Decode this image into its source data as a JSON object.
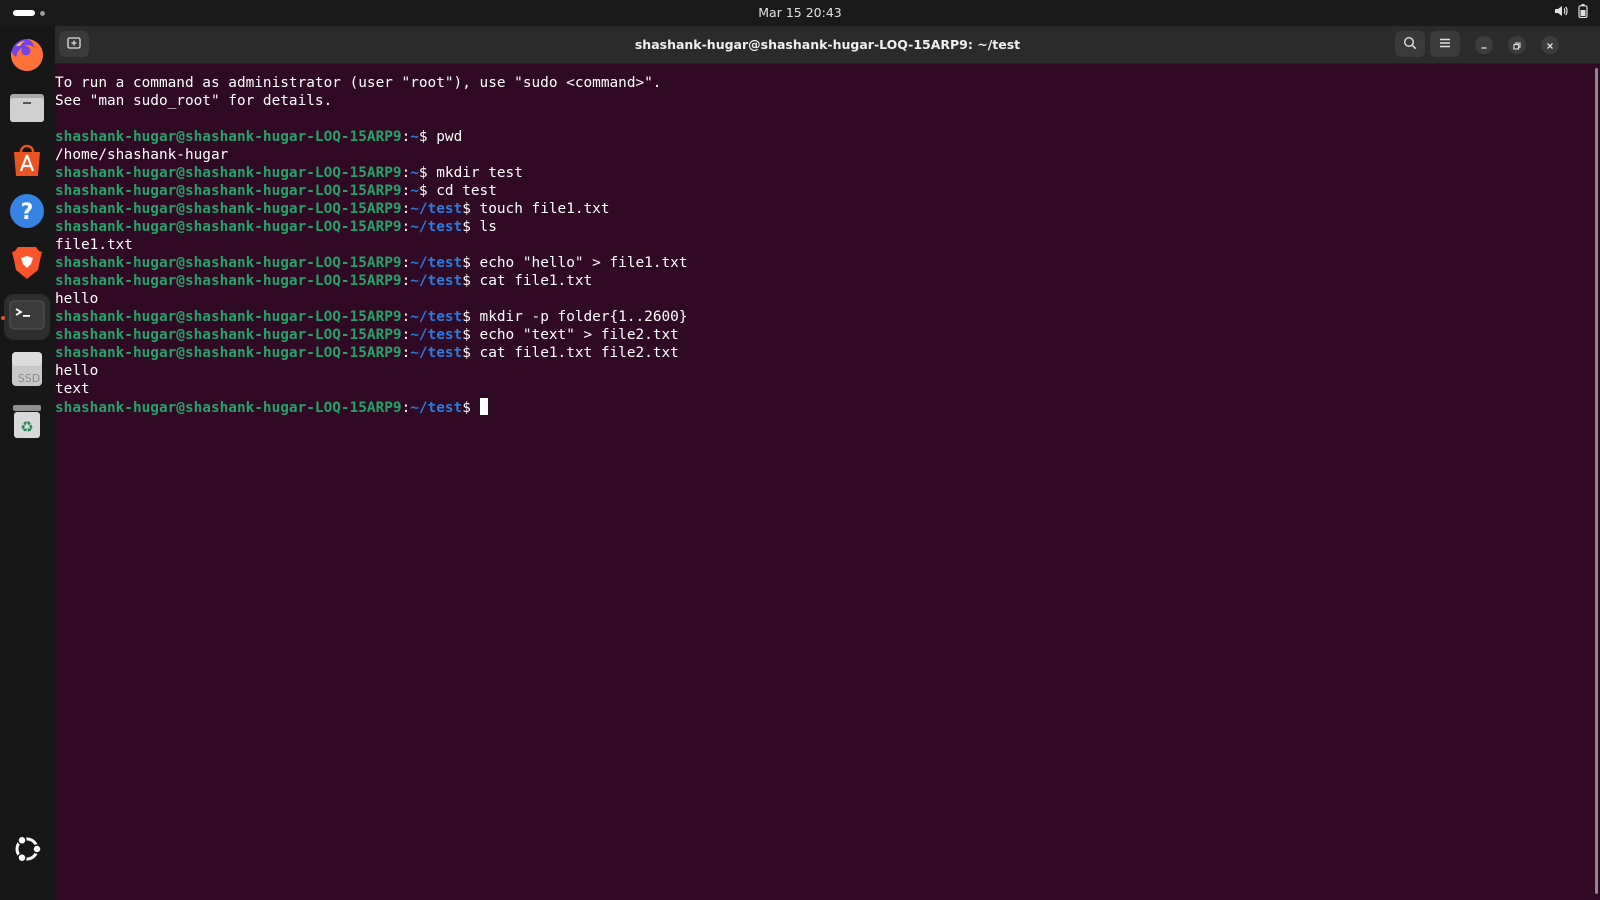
{
  "topbar": {
    "clock": "Mar 15  20:43",
    "icons": [
      "activities-indicator",
      "volume-icon",
      "battery-icon"
    ]
  },
  "dock": {
    "items": [
      {
        "name": "firefox",
        "icon": "firefox-icon"
      },
      {
        "name": "files",
        "icon": "files-icon"
      },
      {
        "name": "app-center",
        "icon": "app-center-icon"
      },
      {
        "name": "help",
        "icon": "help-icon"
      },
      {
        "name": "brave",
        "icon": "brave-icon"
      },
      {
        "name": "terminal",
        "icon": "terminal-icon",
        "active": true
      },
      {
        "name": "ssd-drive",
        "icon": "drive-icon",
        "label": "SSD"
      },
      {
        "name": "trash",
        "icon": "trash-icon"
      },
      {
        "name": "show-apps",
        "icon": "ubuntu-icon"
      }
    ]
  },
  "window": {
    "title": "shashank-hugar@shashank-hugar-LOQ-15ARP9: ~/test"
  },
  "colors": {
    "terminal_bg": "#300a24",
    "prompt_user": "#26a269",
    "prompt_path": "#2a7bde",
    "accent": "#e95420"
  },
  "terminal": {
    "lines": [
      {
        "text": "To run a command as administrator (user \"root\"), use \"sudo <command>\"."
      },
      {
        "text": "See \"man sudo_root\" for details."
      },
      {
        "text": ""
      },
      {
        "prompt": "shashank-hugar@shashank-hugar-LOQ-15ARP9",
        "path": "~",
        "cmd": " pwd"
      },
      {
        "text": "/home/shashank-hugar"
      },
      {
        "prompt": "shashank-hugar@shashank-hugar-LOQ-15ARP9",
        "path": "~",
        "cmd": " mkdir test"
      },
      {
        "prompt": "shashank-hugar@shashank-hugar-LOQ-15ARP9",
        "path": "~",
        "cmd": " cd test"
      },
      {
        "prompt": "shashank-hugar@shashank-hugar-LOQ-15ARP9",
        "path": "~/test",
        "cmd": " touch file1.txt"
      },
      {
        "prompt": "shashank-hugar@shashank-hugar-LOQ-15ARP9",
        "path": "~/test",
        "cmd": " ls"
      },
      {
        "text": "file1.txt"
      },
      {
        "prompt": "shashank-hugar@shashank-hugar-LOQ-15ARP9",
        "path": "~/test",
        "cmd": " echo \"hello\" > file1.txt"
      },
      {
        "prompt": "shashank-hugar@shashank-hugar-LOQ-15ARP9",
        "path": "~/test",
        "cmd": " cat file1.txt"
      },
      {
        "text": "hello"
      },
      {
        "prompt": "shashank-hugar@shashank-hugar-LOQ-15ARP9",
        "path": "~/test",
        "cmd": " mkdir -p folder{1..2600}"
      },
      {
        "prompt": "shashank-hugar@shashank-hugar-LOQ-15ARP9",
        "path": "~/test",
        "cmd": " echo \"text\" > file2.txt"
      },
      {
        "prompt": "shashank-hugar@shashank-hugar-LOQ-15ARP9",
        "path": "~/test",
        "cmd": " cat file1.txt file2.txt"
      },
      {
        "text": "hello"
      },
      {
        "text": "text"
      },
      {
        "prompt": "shashank-hugar@shashank-hugar-LOQ-15ARP9",
        "path": "~/test",
        "cmd": " ",
        "cursor": true
      }
    ]
  }
}
